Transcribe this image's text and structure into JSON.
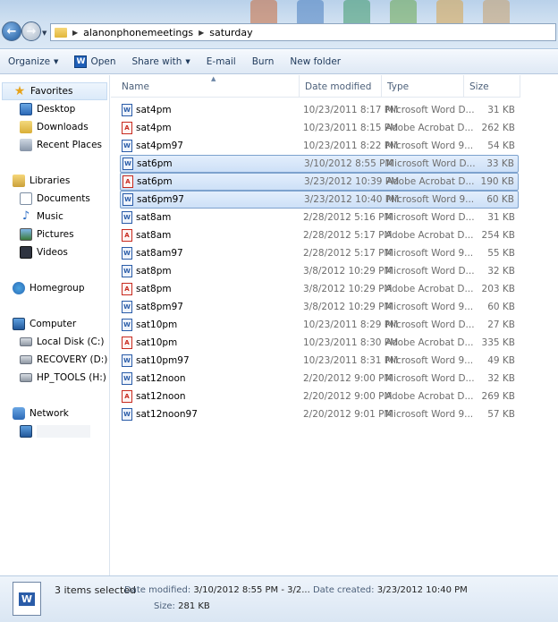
{
  "address": {
    "path": [
      "alanonphonemeetings",
      "saturday"
    ]
  },
  "toolbar": {
    "organize": "Organize",
    "open": "Open",
    "share_with": "Share with",
    "email": "E-mail",
    "burn": "Burn",
    "new_folder": "New folder"
  },
  "nav": {
    "favorites": "Favorites",
    "desktop": "Desktop",
    "downloads": "Downloads",
    "recent": "Recent Places",
    "libraries": "Libraries",
    "documents": "Documents",
    "music": "Music",
    "pictures": "Pictures",
    "videos": "Videos",
    "homegroup": "Homegroup",
    "computer": "Computer",
    "local_disk": "Local Disk (C:)",
    "recovery": "RECOVERY (D:)",
    "hp_tools": "HP_TOOLS (H:)",
    "network": "Network"
  },
  "columns": {
    "name": "Name",
    "date": "Date modified",
    "type": "Type",
    "size": "Size"
  },
  "files": [
    {
      "name": "sat4pm",
      "kind": "word",
      "date": "10/23/2011 8:17 PM",
      "type": "Microsoft Word D...",
      "size": "31 KB",
      "selected": false
    },
    {
      "name": "sat4pm",
      "kind": "pdf",
      "date": "10/23/2011 8:15 PM",
      "type": "Adobe Acrobat D...",
      "size": "262 KB",
      "selected": false
    },
    {
      "name": "sat4pm97",
      "kind": "word",
      "date": "10/23/2011 8:22 PM",
      "type": "Microsoft Word 9...",
      "size": "54 KB",
      "selected": false
    },
    {
      "name": "sat6pm",
      "kind": "word",
      "date": "3/10/2012 8:55 PM",
      "type": "Microsoft Word D...",
      "size": "33 KB",
      "selected": true
    },
    {
      "name": "sat6pm",
      "kind": "pdf",
      "date": "3/23/2012 10:39 PM",
      "type": "Adobe Acrobat D...",
      "size": "190 KB",
      "selected": true
    },
    {
      "name": "sat6pm97",
      "kind": "word",
      "date": "3/23/2012 10:40 PM",
      "type": "Microsoft Word 9...",
      "size": "60 KB",
      "selected": true
    },
    {
      "name": "sat8am",
      "kind": "word",
      "date": "2/28/2012 5:16 PM",
      "type": "Microsoft Word D...",
      "size": "31 KB",
      "selected": false
    },
    {
      "name": "sat8am",
      "kind": "pdf",
      "date": "2/28/2012 5:17 PM",
      "type": "Adobe Acrobat D...",
      "size": "254 KB",
      "selected": false
    },
    {
      "name": "sat8am97",
      "kind": "word",
      "date": "2/28/2012 5:17 PM",
      "type": "Microsoft Word 9...",
      "size": "55 KB",
      "selected": false
    },
    {
      "name": "sat8pm",
      "kind": "word",
      "date": "3/8/2012 10:29 PM",
      "type": "Microsoft Word D...",
      "size": "32 KB",
      "selected": false
    },
    {
      "name": "sat8pm",
      "kind": "pdf",
      "date": "3/8/2012 10:29 PM",
      "type": "Adobe Acrobat D...",
      "size": "203 KB",
      "selected": false
    },
    {
      "name": "sat8pm97",
      "kind": "word",
      "date": "3/8/2012 10:29 PM",
      "type": "Microsoft Word 9...",
      "size": "60 KB",
      "selected": false
    },
    {
      "name": "sat10pm",
      "kind": "word",
      "date": "10/23/2011 8:29 PM",
      "type": "Microsoft Word D...",
      "size": "27 KB",
      "selected": false
    },
    {
      "name": "sat10pm",
      "kind": "pdf",
      "date": "10/23/2011 8:30 PM",
      "type": "Adobe Acrobat D...",
      "size": "335 KB",
      "selected": false
    },
    {
      "name": "sat10pm97",
      "kind": "word",
      "date": "10/23/2011 8:31 PM",
      "type": "Microsoft Word 9...",
      "size": "49 KB",
      "selected": false
    },
    {
      "name": "sat12noon",
      "kind": "word",
      "date": "2/20/2012 9:00 PM",
      "type": "Microsoft Word D...",
      "size": "32 KB",
      "selected": false
    },
    {
      "name": "sat12noon",
      "kind": "pdf",
      "date": "2/20/2012 9:00 PM",
      "type": "Adobe Acrobat D...",
      "size": "269 KB",
      "selected": false
    },
    {
      "name": "sat12noon97",
      "kind": "word",
      "date": "2/20/2012 9:01 PM",
      "type": "Microsoft Word 9...",
      "size": "57 KB",
      "selected": false
    }
  ],
  "details": {
    "count": "3 items selected",
    "date_modified_label": "Date modified:",
    "date_modified_value": "3/10/2012 8:55 PM - 3/2...",
    "date_created_label": "Date created:",
    "date_created_value": "3/23/2012 10:40 PM",
    "size_label": "Size:",
    "size_value": "281 KB"
  },
  "colors": {
    "selection_fill": "#cde0f7",
    "selection_border": "#7da2ce",
    "word_blue": "#2a5ca8",
    "pdf_red": "#c72a1f"
  }
}
